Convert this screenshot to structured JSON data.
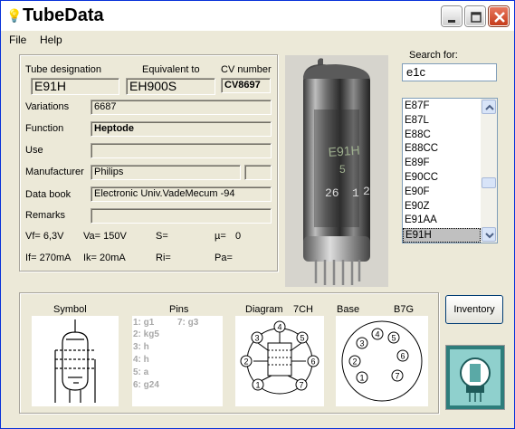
{
  "window": {
    "title": "TubeData",
    "icon": "bulb-icon"
  },
  "menu": {
    "file": "File",
    "help": "Help"
  },
  "header": {
    "designation_label": "Tube designation",
    "equivalent_label": "Equivalent to",
    "cv_label": "CV number",
    "designation": "E91H",
    "equivalent": "EH900S",
    "cv": "CV8697"
  },
  "fields": {
    "variations_label": "Variations",
    "variations": "6687",
    "function_label": "Function",
    "function": "Heptode",
    "use_label": "Use",
    "use": "",
    "manufacturer_label": "Manufacturer",
    "manufacturer": "Philips",
    "manufacturer_extra": "",
    "databook_label": "Data book",
    "databook": "Electronic Univ.VadeMecum -94",
    "remarks_label": "Remarks",
    "remarks": ""
  },
  "params": {
    "vf": "Vf= 6,3V",
    "va": "Va= 150V",
    "s": "S=",
    "mu_label": "µ=",
    "mu": "0",
    "if": "If= 270mA",
    "ik": "Ik= 20mA",
    "ri": "Ri=",
    "pa": "Pa="
  },
  "photo": {
    "markings": [
      "E91H",
      "5",
      "26",
      "1",
      "2"
    ]
  },
  "search": {
    "label": "Search for:",
    "value": "e1c"
  },
  "list": {
    "items": [
      "E87F",
      "E87L",
      "E88C",
      "E88CC",
      "E89F",
      "E90CC",
      "E90F",
      "E90Z",
      "E91AA",
      "E91H"
    ],
    "selected": "E91H"
  },
  "bottom": {
    "symbol_label": "Symbol",
    "pins_label": "Pins",
    "diagram_label": "Diagram",
    "diagram_code": "7CH",
    "base_label": "Base",
    "base_code": "B7G",
    "pins_col1": [
      "1: g1",
      "2: kg5",
      "3: h",
      "4: h",
      "5: a",
      "6: g24"
    ],
    "pins_col2": [
      "7: g3"
    ],
    "diagram_pins": [
      "1",
      "2",
      "3",
      "4",
      "5",
      "6",
      "7"
    ]
  },
  "inventory_label": "Inventory"
}
